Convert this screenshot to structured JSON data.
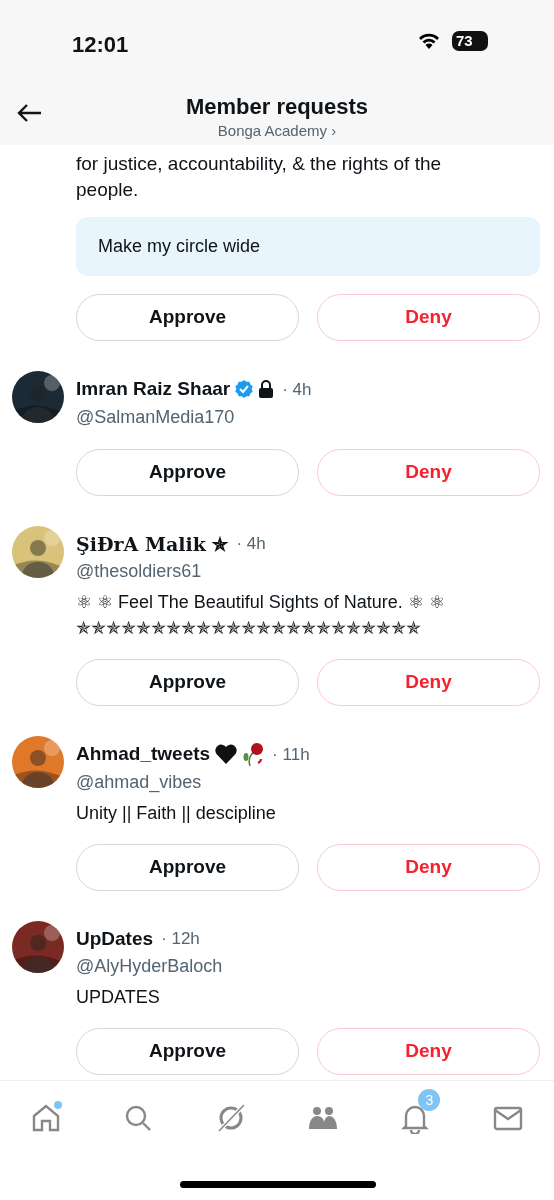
{
  "status_bar": {
    "time": "12:01",
    "battery": "73"
  },
  "header": {
    "title": "Member requests",
    "subtitle": "Bonga Academy ›"
  },
  "first_request": {
    "bio": "for justice, accountability, & the rights of the people.",
    "message": "Make my circle wide",
    "approve": "Approve",
    "deny": "Deny"
  },
  "requests": [
    {
      "name": "Imran Raiz Shaar",
      "badges": [
        {
          "kind": "verified"
        },
        {
          "kind": "lock"
        }
      ],
      "time": "· 4h",
      "handle": "@SalmanMedia170",
      "avatar": {
        "kind": "picture"
      },
      "approve": "Approve",
      "deny": "Deny"
    },
    {
      "name": "ŞiĐrA Malik ✯",
      "time": "· 4h",
      "handle": "@thesoldiers61",
      "bio_lines": [
        "⚛ ⚛ Feel The Beautiful Sights of Nature.  ⚛ ⚛",
        "✯✯✯✯✯✯✯✯✯✯✯✯✯✯✯✯✯✯✯✯✯✯✯"
      ],
      "avatar": {
        "kind": "picture"
      },
      "approve": "Approve",
      "deny": "Deny"
    },
    {
      "name": "Ahmad_tweets",
      "badges": [
        {
          "kind": "heart"
        },
        {
          "kind": "rose"
        }
      ],
      "time": "· 11h",
      "handle": "@ahmad_vibes",
      "bio_lines": [
        "Unity || Faith || descipline"
      ],
      "avatar": {
        "kind": "picture"
      },
      "approve": "Approve",
      "deny": "Deny"
    },
    {
      "name": "UpDates",
      "time": "· 12h",
      "handle": "@AlyHyderBaloch",
      "bio_lines": [
        "UPDATES"
      ],
      "avatar": {
        "kind": "picture"
      },
      "approve": "Approve",
      "deny": "Deny"
    }
  ],
  "tab_bar": [
    {
      "kind": "home",
      "dot": true
    },
    {
      "kind": "search"
    },
    {
      "kind": "grok"
    },
    {
      "kind": "communities"
    },
    {
      "kind": "notifications",
      "count": "3"
    },
    {
      "kind": "messages"
    }
  ]
}
